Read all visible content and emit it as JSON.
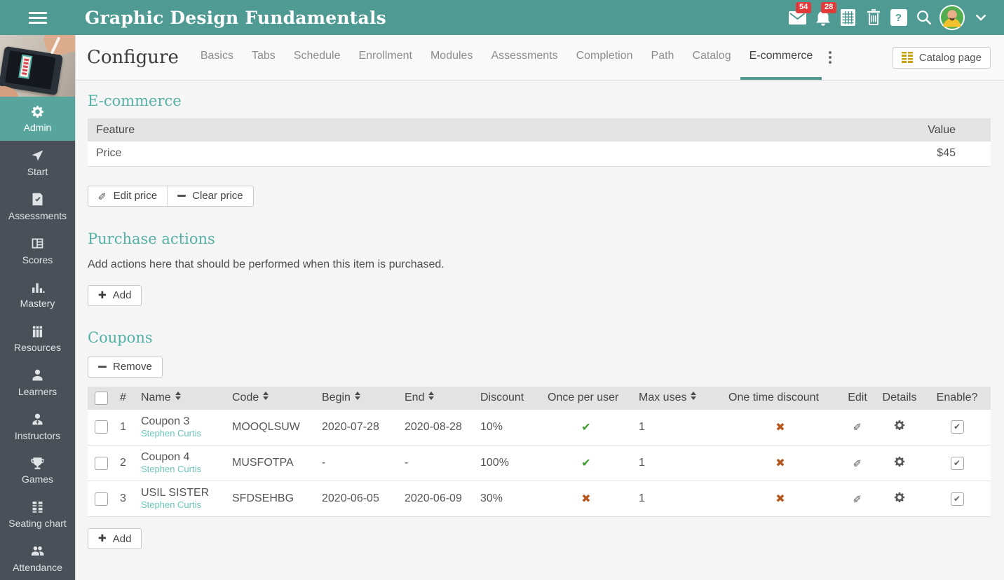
{
  "colors": {
    "accent_teal": "#4f9b94",
    "sidebar_active_teal": "#57a59d",
    "heading_teal": "#54b1a6",
    "owner_link_teal": "#6cc5b9",
    "success_green": "#3e9e2f",
    "danger_orange": "#b5561d",
    "badge_red": "#e23b3b",
    "catalog_icon_gold": "#c7a00d"
  },
  "topbar": {
    "title": "Graphic Design Fundamentals",
    "messages_badge": "54",
    "notifications_badge": "28",
    "icons": [
      "hamburger-menu-icon",
      "messages-icon",
      "notifications-icon",
      "gradebook-grid-icon",
      "trash-icon",
      "help-icon",
      "search-icon",
      "avatar",
      "chevron-down-icon"
    ]
  },
  "sidebar": {
    "items": [
      {
        "label": "Admin",
        "icon": "gear-icon",
        "active": true
      },
      {
        "label": "Start",
        "icon": "send-icon",
        "active": false
      },
      {
        "label": "Assessments",
        "icon": "assignment-check-icon",
        "active": false
      },
      {
        "label": "Scores",
        "icon": "scores-table-icon",
        "active": false
      },
      {
        "label": "Mastery",
        "icon": "bar-chart-icon",
        "active": false
      },
      {
        "label": "Resources",
        "icon": "books-icon",
        "active": false
      },
      {
        "label": "Learners",
        "icon": "person-icon",
        "active": false
      },
      {
        "label": "Instructors",
        "icon": "instructor-icon",
        "active": false
      },
      {
        "label": "Games",
        "icon": "trophy-icon",
        "active": false
      },
      {
        "label": "Seating chart",
        "icon": "seating-grid-icon",
        "active": false
      },
      {
        "label": "Attendance",
        "icon": "people-group-icon",
        "active": false
      }
    ]
  },
  "header": {
    "page_title": "Configure",
    "tabs": [
      "Basics",
      "Tabs",
      "Schedule",
      "Enrollment",
      "Modules",
      "Assessments",
      "Completion",
      "Path",
      "Catalog",
      "E-commerce"
    ],
    "active_tab": "E-commerce",
    "catalog_page_button": "Catalog page"
  },
  "ecommerce": {
    "heading": "E-commerce",
    "feature_table": {
      "columns": [
        "Feature",
        "Value"
      ],
      "rows": [
        {
          "feature": "Price",
          "value": "$45"
        }
      ]
    },
    "edit_price_button": "Edit price",
    "clear_price_button": "Clear price"
  },
  "purchase_actions": {
    "heading": "Purchase actions",
    "description": "Add actions here that should be performed when this item is purchased.",
    "add_button": "Add"
  },
  "coupons": {
    "heading": "Coupons",
    "remove_button": "Remove",
    "add_button": "Add",
    "columns": [
      "#",
      "Name",
      "Code",
      "Begin",
      "End",
      "Discount",
      "Once per user",
      "Max uses",
      "One time discount",
      "Edit",
      "Details",
      "Enable?"
    ],
    "sortable_columns": [
      "Name",
      "Code",
      "Begin",
      "End",
      "Max uses"
    ],
    "rows": [
      {
        "num": "1",
        "name": "Coupon 3",
        "owner": "Stephen Curtis",
        "code": "MOOQLSUW",
        "begin": "2020-07-28",
        "end": "2020-08-28",
        "discount": "10%",
        "once_per_user": true,
        "max_uses": "1",
        "one_time_discount": false,
        "enabled": true
      },
      {
        "num": "2",
        "name": "Coupon 4",
        "owner": "Stephen Curtis",
        "code": "MUSFOTPA",
        "begin": "-",
        "end": "-",
        "discount": "100%",
        "once_per_user": true,
        "max_uses": "1",
        "one_time_discount": false,
        "enabled": true
      },
      {
        "num": "3",
        "name": "USIL SISTER",
        "owner": "Stephen Curtis",
        "code": "SFDSEHBG",
        "begin": "2020-06-05",
        "end": "2020-06-09",
        "discount": "30%",
        "once_per_user": false,
        "max_uses": "1",
        "one_time_discount": false,
        "enabled": true
      }
    ]
  }
}
